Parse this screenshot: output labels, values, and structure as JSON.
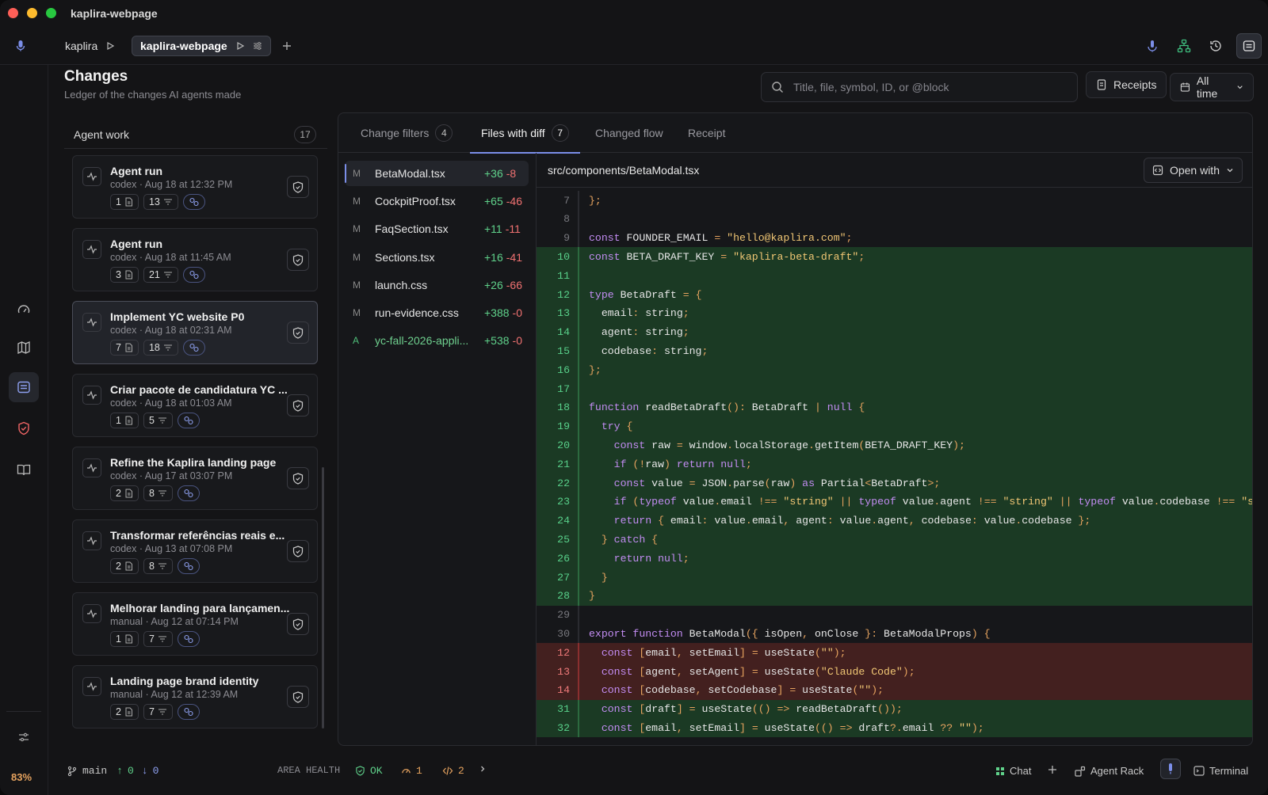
{
  "window": {
    "title": "kaplira-webpage"
  },
  "project_tabs": [
    {
      "label": "kaplira"
    },
    {
      "label": "kaplira-webpage"
    }
  ],
  "page": {
    "title": "Changes",
    "subtitle": "Ledger of the changes AI agents made"
  },
  "search": {
    "placeholder": "Title, file, symbol, ID, or @block"
  },
  "toolbar": {
    "receipts_label": "Receipts",
    "time_filter": "All time"
  },
  "agent_work": {
    "label": "Agent work",
    "count": "17",
    "runs": [
      {
        "title": "Agent run",
        "meta": "codex · Aug 18 at 12:32 PM",
        "files": "1",
        "changes": "13"
      },
      {
        "title": "Agent run",
        "meta": "codex · Aug 18 at 11:45 AM",
        "files": "3",
        "changes": "21"
      },
      {
        "title": "Implement YC website P0",
        "meta": "codex · Aug 18 at 02:31 AM",
        "files": "7",
        "changes": "18"
      },
      {
        "title": "Criar pacote de candidatura YC ...",
        "meta": "codex · Aug 18 at 01:03 AM",
        "files": "1",
        "changes": "5"
      },
      {
        "title": "Refine the Kaplira landing page",
        "meta": "codex · Aug 17 at 03:07 PM",
        "files": "2",
        "changes": "8"
      },
      {
        "title": "Transformar referências reais e...",
        "meta": "codex · Aug 13 at 07:08 PM",
        "files": "2",
        "changes": "8"
      },
      {
        "title": "Melhorar landing para lançamen...",
        "meta": "manual · Aug 12 at 07:14 PM",
        "files": "1",
        "changes": "7"
      },
      {
        "title": "Landing page brand identity",
        "meta": "manual · Aug 12 at 12:39 AM",
        "files": "2",
        "changes": "7"
      }
    ]
  },
  "detail_tabs": [
    {
      "label": "Change filters",
      "count": "4"
    },
    {
      "label": "Files with diff",
      "count": "7"
    },
    {
      "label": "Changed flow"
    },
    {
      "label": "Receipt"
    }
  ],
  "files": [
    {
      "status": "M",
      "name": "BetaModal.tsx",
      "add": "+36",
      "del": "-8"
    },
    {
      "status": "M",
      "name": "CockpitProof.tsx",
      "add": "+65",
      "del": "-46"
    },
    {
      "status": "M",
      "name": "FaqSection.tsx",
      "add": "+11",
      "del": "-11"
    },
    {
      "status": "M",
      "name": "Sections.tsx",
      "add": "+16",
      "del": "-41"
    },
    {
      "status": "M",
      "name": "launch.css",
      "add": "+26",
      "del": "-66"
    },
    {
      "status": "M",
      "name": "run-evidence.css",
      "add": "+388",
      "del": "-0"
    },
    {
      "status": "A",
      "name": "yc-fall-2026-appli...",
      "add": "+538",
      "del": "-0"
    }
  ],
  "diff": {
    "path": "src/components/BetaModal.tsx",
    "open_with": "Open with",
    "lines": [
      {
        "n": "7",
        "type": "ctx",
        "text": "};"
      },
      {
        "n": "8",
        "type": "ctx",
        "text": ""
      },
      {
        "n": "9",
        "type": "ctx",
        "text": "const FOUNDER_EMAIL = \"hello@kaplira.com\";"
      },
      {
        "n": "10",
        "type": "add",
        "text": "const BETA_DRAFT_KEY = \"kaplira-beta-draft\";"
      },
      {
        "n": "11",
        "type": "add",
        "text": ""
      },
      {
        "n": "12",
        "type": "add",
        "text": "type BetaDraft = {"
      },
      {
        "n": "13",
        "type": "add",
        "text": "  email: string;"
      },
      {
        "n": "14",
        "type": "add",
        "text": "  agent: string;"
      },
      {
        "n": "15",
        "type": "add",
        "text": "  codebase: string;"
      },
      {
        "n": "16",
        "type": "add",
        "text": "};"
      },
      {
        "n": "17",
        "type": "add",
        "text": ""
      },
      {
        "n": "18",
        "type": "add",
        "text": "function readBetaDraft(): BetaDraft | null {"
      },
      {
        "n": "19",
        "type": "add",
        "text": "  try {"
      },
      {
        "n": "20",
        "type": "add",
        "text": "    const raw = window.localStorage.getItem(BETA_DRAFT_KEY);"
      },
      {
        "n": "21",
        "type": "add",
        "text": "    if (!raw) return null;"
      },
      {
        "n": "22",
        "type": "add",
        "text": "    const value = JSON.parse(raw) as Partial<BetaDraft>;"
      },
      {
        "n": "23",
        "type": "add",
        "text": "    if (typeof value.email !== \"string\" || typeof value.agent !== \"string\" || typeof value.codebase !== \"s"
      },
      {
        "n": "24",
        "type": "add",
        "text": "    return { email: value.email, agent: value.agent, codebase: value.codebase };"
      },
      {
        "n": "25",
        "type": "add",
        "text": "  } catch {"
      },
      {
        "n": "26",
        "type": "add",
        "text": "    return null;"
      },
      {
        "n": "27",
        "type": "add",
        "text": "  }"
      },
      {
        "n": "28",
        "type": "add",
        "text": "}"
      },
      {
        "n": "29",
        "type": "ctx",
        "text": ""
      },
      {
        "n": "30",
        "type": "ctx",
        "text": "export function BetaModal({ isOpen, onClose }: BetaModalProps) {"
      },
      {
        "n": "12",
        "type": "del",
        "text": "  const [email, setEmail] = useState(\"\");"
      },
      {
        "n": "13",
        "type": "del",
        "text": "  const [agent, setAgent] = useState(\"Claude Code\");"
      },
      {
        "n": "14",
        "type": "del",
        "text": "  const [codebase, setCodebase] = useState(\"\");"
      },
      {
        "n": "31",
        "type": "add",
        "text": "  const [draft] = useState(() => readBetaDraft());"
      },
      {
        "n": "32",
        "type": "add",
        "text": "  const [email, setEmail] = useState(() => draft?.email ?? \"\");"
      }
    ]
  },
  "rail": {
    "zoom": "83%"
  },
  "status": {
    "branch": "main",
    "ahead": "0",
    "behind": "0",
    "area_health_label": "AREA HEALTH",
    "health": "OK",
    "warnings": "1",
    "code_issues": "2",
    "chat": "Chat",
    "agent_rack": "Agent Rack",
    "terminal": "Terminal"
  },
  "colors": {
    "accent": "#7b8ee8",
    "added": "#1b3a24",
    "removed": "#43201f",
    "add_text": "#5fd18a",
    "del_text": "#f07171"
  }
}
